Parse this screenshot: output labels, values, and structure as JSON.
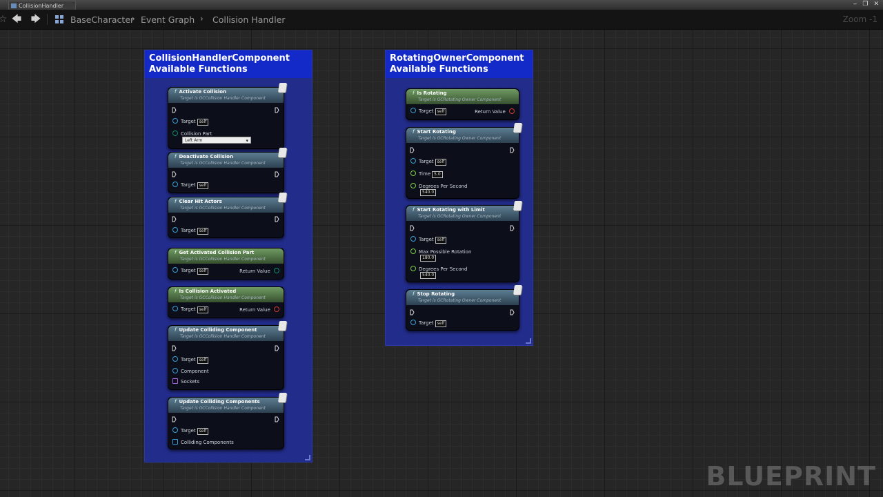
{
  "window": {
    "tab_title": "CollisionHandler",
    "controls": [
      "‒",
      "❐",
      "✕"
    ]
  },
  "nav": {
    "crumbs": [
      "BaseCharacter",
      "Event Graph",
      "Collision Handler"
    ],
    "zoom": "Zoom -1"
  },
  "comments": [
    {
      "title_line1": "CollisionHandlerComponent",
      "title_line2": "Available Functions",
      "nodes": [
        {
          "title": "Activate Collision",
          "subtitle": "Target is GCCollision Handler Component",
          "pure": false,
          "target": "Target",
          "self": "self",
          "extra_label": "Collision Part",
          "dropdown": "Left Arm"
        },
        {
          "title": "Deactivate Collision",
          "subtitle": "Target is GCCollision Handler Component",
          "pure": false,
          "target": "Target",
          "self": "self"
        },
        {
          "title": "Clear Hit Actors",
          "subtitle": "Target is GCCollision Handler Component",
          "pure": false,
          "target": "Target",
          "self": "self"
        },
        {
          "title": "Get Activated Collision Part",
          "subtitle": "Target is GCCollision Handler Component",
          "pure": true,
          "target": "Target",
          "self": "self",
          "return": "Return Value"
        },
        {
          "title": "Is Collision Activated",
          "subtitle": "Target is GCCollision Handler Component",
          "pure": true,
          "target": "Target",
          "self": "self",
          "return": "Return Value"
        },
        {
          "title": "Update Colliding Component",
          "subtitle": "Target is GCCollision Handler Component",
          "pure": false,
          "target": "Target",
          "self": "self",
          "pins": [
            "Component",
            "Sockets"
          ]
        },
        {
          "title": "Update Colliding Components",
          "subtitle": "Target is GCCollision Handler Component",
          "pure": false,
          "target": "Target",
          "self": "self",
          "pins": [
            "Colliding Components"
          ]
        }
      ]
    },
    {
      "title_line1": "RotatingOwnerComponent",
      "title_line2": "Available Functions",
      "nodes": [
        {
          "title": "Is Rotating",
          "subtitle": "Target is GCRotating Owner Component",
          "pure": true,
          "target": "Target",
          "self": "self",
          "return": "Return Value"
        },
        {
          "title": "Start Rotating",
          "subtitle": "Target is GCRotating Owner Component",
          "pure": false,
          "target": "Target",
          "self": "self",
          "params": [
            {
              "label": "Time",
              "value": "5.0"
            },
            {
              "label": "Degrees Per Second",
              "value": "540.0"
            }
          ]
        },
        {
          "title": "Start Rotating with Limit",
          "subtitle": "Target is GCRotating Owner Component",
          "pure": false,
          "target": "Target",
          "self": "self",
          "params": [
            {
              "label": "Max Possible Rotation",
              "value": "180.0"
            },
            {
              "label": "Degrees Per Second",
              "value": "540.0"
            }
          ]
        },
        {
          "title": "Stop Rotating",
          "subtitle": "Target is GCRotating Owner Component",
          "pure": false,
          "target": "Target",
          "self": "self"
        }
      ]
    }
  ],
  "watermark": "BLUEPRINT",
  "colors": {
    "comment_header": "#1329c8",
    "comment_body": "#222e96",
    "impure_header": "#4b6b80",
    "pure_header": "#5e8a52",
    "object_pin": "#3aa0d6",
    "float_pin": "#7ecf47",
    "bool_pin": "#d43a2e"
  }
}
